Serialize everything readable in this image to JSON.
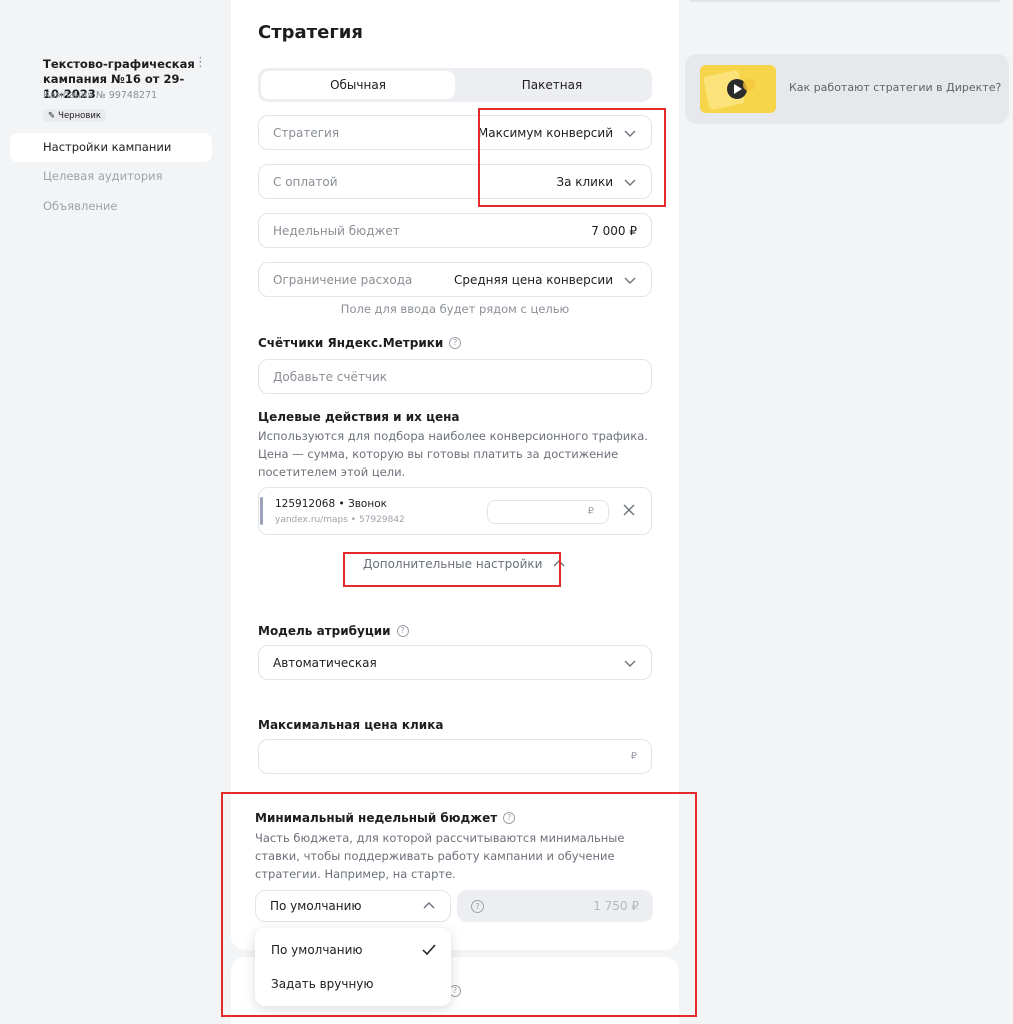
{
  "sidebar": {
    "campaign_title": "Текстово-графическая кампания №16 от 29-10-2023",
    "campaign_number": "Кампания № 99748271",
    "draft_badge": "Черновик",
    "menu_icon": "kebab-icon",
    "items": [
      {
        "label": "Настройки кампании",
        "active": true
      },
      {
        "label": "Целевая аудитория",
        "active": false
      },
      {
        "label": "Объявление",
        "active": false
      }
    ]
  },
  "main": {
    "title": "Стратегия",
    "tabs": [
      {
        "label": "Обычная",
        "active": true
      },
      {
        "label": "Пакетная",
        "active": false
      }
    ],
    "strategy": {
      "label": "Стратегия",
      "value": "Максимум конверсий"
    },
    "payment": {
      "label": "С оплатой",
      "value": "За клики"
    },
    "weekly_budget": {
      "label": "Недельный бюджет",
      "value": "7 000 ₽"
    },
    "spend_limit": {
      "label": "Ограничение расхода",
      "value": "Средняя цена конверсии"
    },
    "spend_hint": "Поле для ввода будет рядом с целью",
    "counters": {
      "title": "Счётчики Яндекс.Метрики",
      "placeholder": "Добавьте счётчик"
    },
    "goals": {
      "title": "Целевые действия и их цена",
      "description": "Используются для подбора наиболее конверсионного трафика. Цена — сумма, которую вы готовы платить за достижение посетителем этой цели.",
      "items": [
        {
          "name": "125912068 • Звонок",
          "source": "yandex.ru/maps • 57929842",
          "currency": "₽"
        }
      ]
    },
    "advanced_settings": "Дополнительные настройки",
    "attribution": {
      "title": "Модель атрибуции",
      "value": "Автоматическая"
    },
    "max_click_price": {
      "title": "Максимальная цена клика",
      "currency": "₽"
    },
    "min_weekly_budget": {
      "title": "Минимальный недельный бюджет",
      "description": "Часть бюджета, для которой рассчитываются минимальные ставки, чтобы поддерживать работу кампании и обучение стратегии. Например, на старте.",
      "mode": "По умолчанию",
      "amount": "1 750 ₽",
      "options": [
        {
          "label": "По умолчанию",
          "selected": true
        },
        {
          "label": "Задать вручную",
          "selected": false
        }
      ]
    }
  },
  "help": {
    "text": "Как работают стратегии в Директе?",
    "icon": "play-icon"
  },
  "colors": {
    "highlight": "#e32b2b",
    "accent": "#f7d54a",
    "background": "#f3f4f6"
  }
}
